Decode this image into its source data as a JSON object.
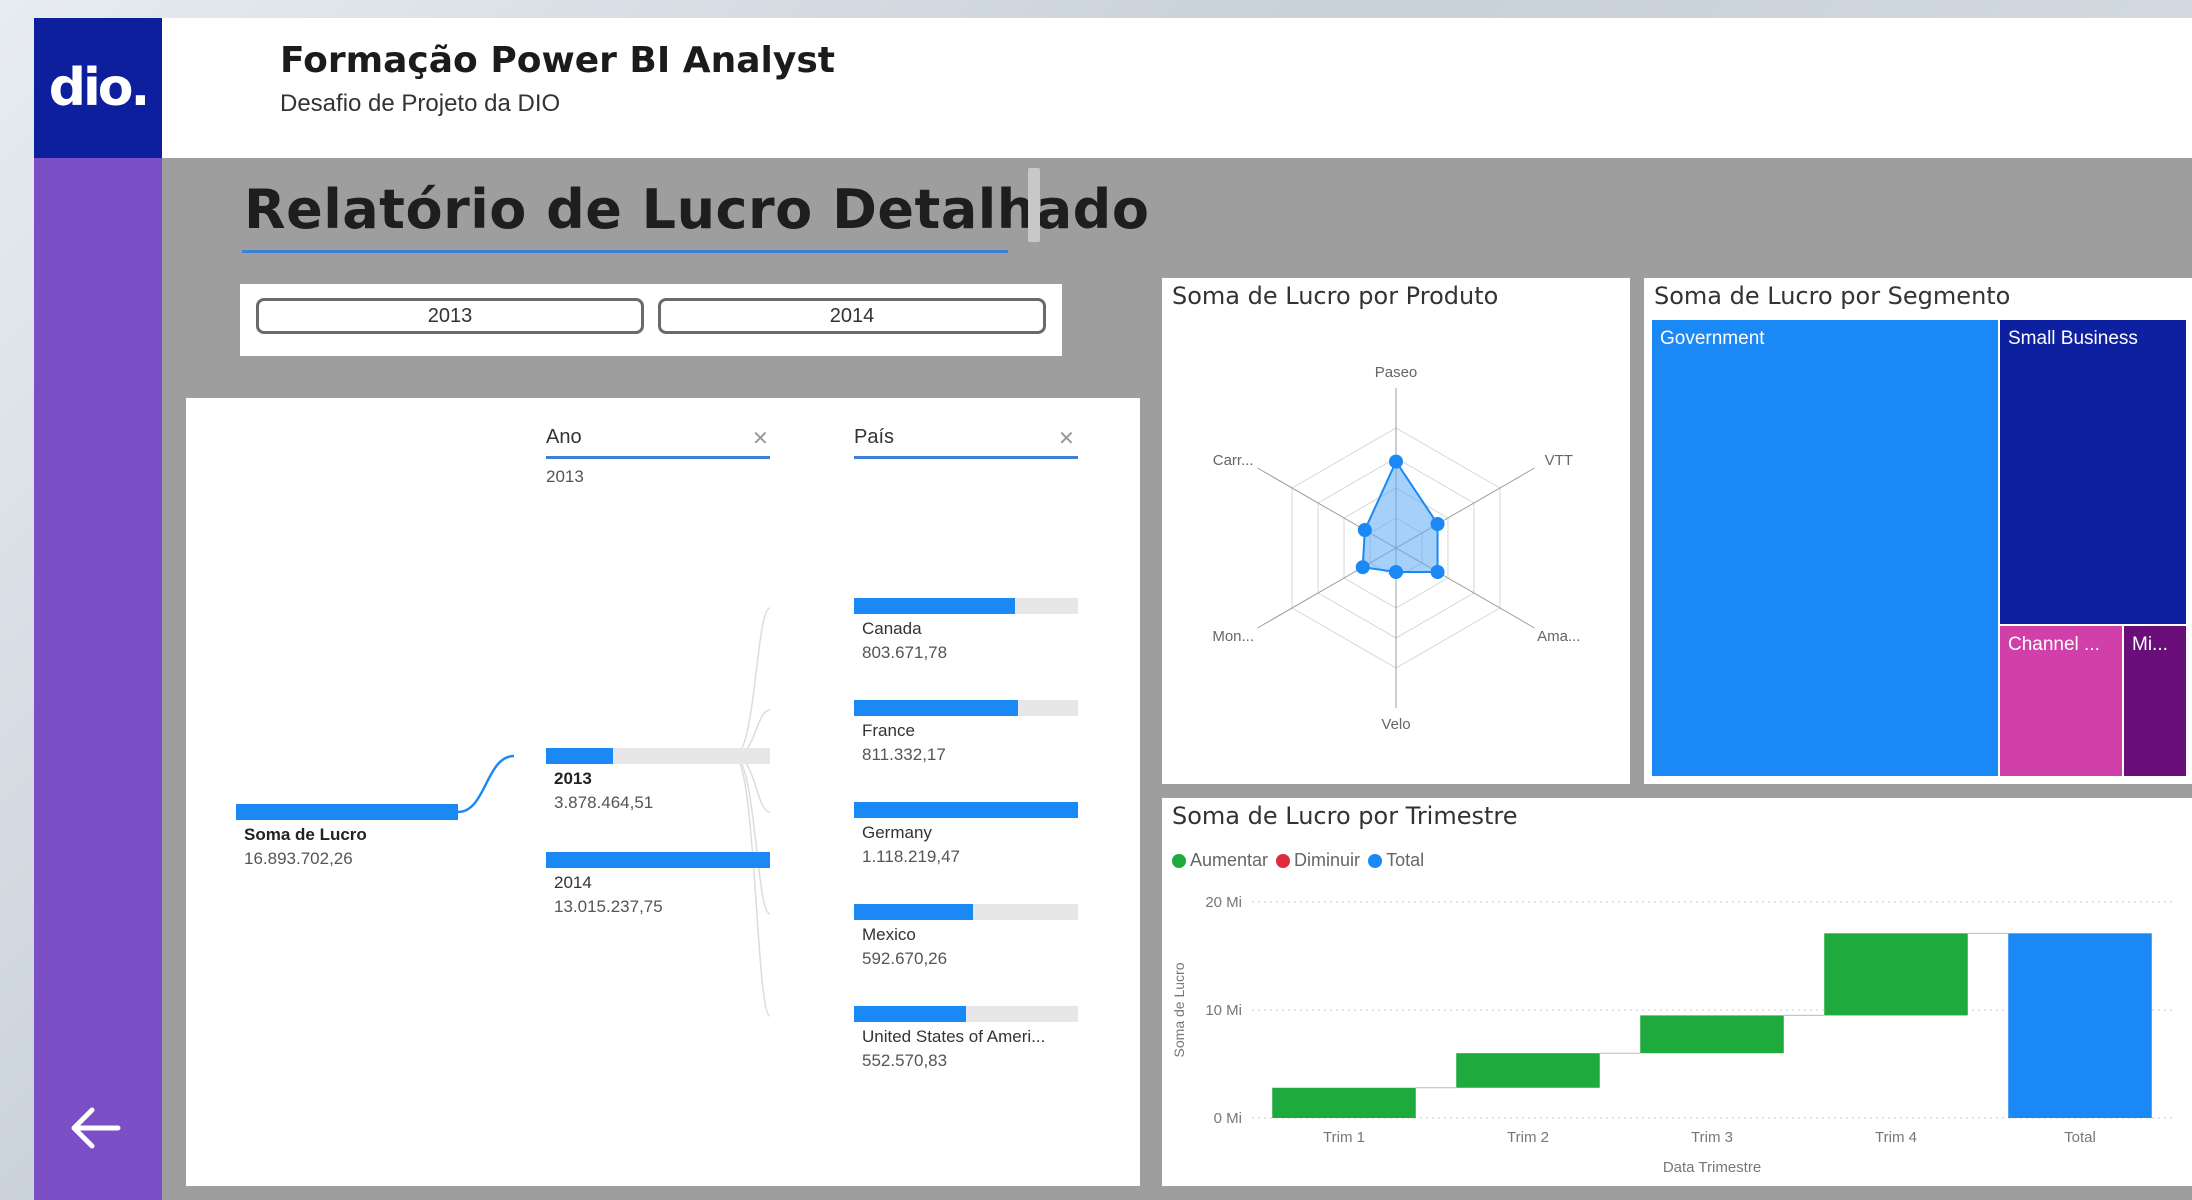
{
  "header": {
    "logo": "dio.",
    "title": "Formação Power BI Analyst",
    "subtitle": "Desafio de Projeto da DIO"
  },
  "nav": {
    "back_icon": "arrow-left-icon"
  },
  "page": {
    "title": "Relatório de Lucro Detalhado"
  },
  "slicer": {
    "options": [
      "2013",
      "2014"
    ]
  },
  "decomposition": {
    "root": {
      "label": "Soma de Lucro",
      "value": "16.893.702,26",
      "fraction": 1.0
    },
    "levels": [
      {
        "header": "Ano",
        "filter": "2013",
        "close": "✕"
      },
      {
        "header": "País",
        "close": "✕"
      }
    ],
    "years": [
      {
        "label": "2013",
        "value": "3.878.464,51",
        "fraction": 0.3
      },
      {
        "label": "2014",
        "value": "13.015.237,75",
        "fraction": 1.0
      }
    ],
    "countries": [
      {
        "label": "Canada",
        "value": "803.671,78",
        "fraction": 0.72
      },
      {
        "label": "France",
        "value": "811.332,17",
        "fraction": 0.73
      },
      {
        "label": "Germany",
        "value": "1.118.219,47",
        "fraction": 1.0
      },
      {
        "label": "Mexico",
        "value": "592.670,26",
        "fraction": 0.53
      },
      {
        "label": "United States of Ameri...",
        "value": "552.570,83",
        "fraction": 0.5
      }
    ]
  },
  "radar": {
    "title": "Soma de Lucro por Produto",
    "axes": [
      "Paseo",
      "VTT",
      "Ama...",
      "Velo",
      "Mon...",
      "Carr..."
    ],
    "values": [
      0.72,
      0.4,
      0.4,
      0.2,
      0.32,
      0.3
    ]
  },
  "treemap": {
    "title": "Soma de Lucro por Segmento",
    "segments": [
      {
        "label": "Government",
        "color": "#1a88f5"
      },
      {
        "label": "Small Business",
        "color": "#0d20a0"
      },
      {
        "label": "Channel ...",
        "color": "#d13fa8"
      },
      {
        "label": "Mi...",
        "color": "#6a0f7a"
      }
    ]
  },
  "waterfall": {
    "title": "Soma de Lucro por Trimestre",
    "legend": [
      {
        "label": "Aumentar",
        "color": "#1eaa3c"
      },
      {
        "label": "Diminuir",
        "color": "#e02b3c"
      },
      {
        "label": "Total",
        "color": "#1a88f5"
      }
    ],
    "chart_data": {
      "type": "bar",
      "categories": [
        "Trim 1",
        "Trim 2",
        "Trim 3",
        "Trim 4",
        "Total"
      ],
      "values": [
        2.8,
        3.2,
        3.5,
        7.6,
        17.1
      ],
      "ylabel": "Soma de Lucro",
      "xlabel": "Data Trimestre",
      "yticks": [
        "0 Mi",
        "10 Mi",
        "20 Mi"
      ],
      "ylim": [
        0,
        20
      ]
    }
  }
}
